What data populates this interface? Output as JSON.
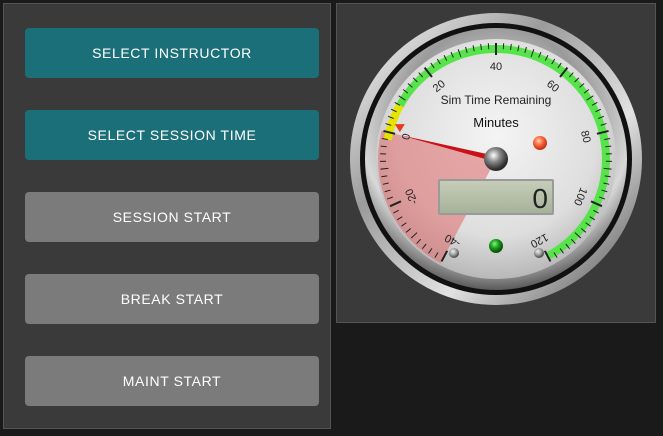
{
  "buttons": {
    "select_instructor": "SELECT INSTRUCTOR",
    "select_session_time": "SELECT SESSION TIME",
    "session_start": "SESSION START",
    "break_start": "BREAK START",
    "maint_start": "MAINT START"
  },
  "gauge": {
    "title": "Sim Time Remaining",
    "unit": "Minutes",
    "display_value": "0",
    "scale_labels": [
      "-40",
      "-20",
      "0",
      "20",
      "40",
      "60",
      "80",
      "100",
      "120"
    ],
    "scale_min": -40,
    "scale_max": 120,
    "needle_value": 0,
    "colors": {
      "button_teal": "#1b6f78",
      "button_gray": "#7b7b7b",
      "green_zone": "#57e34a",
      "red_zone": "#e06a6a",
      "yellow_marker": "#e4e400",
      "indicator_green": "#1aa01a",
      "indicator_orange": "#ff6a3c"
    }
  }
}
